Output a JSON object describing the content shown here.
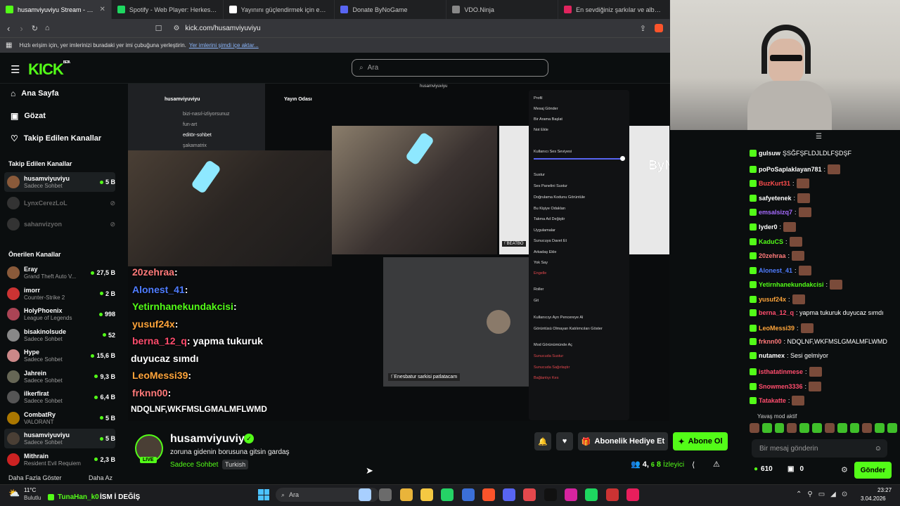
{
  "browser": {
    "tabs": [
      {
        "title": "husamviyuviyu Stream - Wat",
        "active": true,
        "color": "#53fc18"
      },
      {
        "title": "Spotify - Web Player: Herkes için mü",
        "active": false,
        "color": "#1ed760"
      },
      {
        "title": "Yayınını güçlendirmek için en iyi yaz",
        "active": false,
        "color": "#ffffff"
      },
      {
        "title": "Donate ByNoGame",
        "active": false,
        "color": "#5865f2"
      },
      {
        "title": "VDO.Ninja",
        "active": false,
        "color": "#888888"
      },
      {
        "title": "En sevdiğiniz şarkılar ve albümle",
        "active": false,
        "color": "#e0245e"
      }
    ],
    "url": "kick.com/husamviyuviyu",
    "bookmark_bar_text": "Hızlı erişim için, yer imlerinizi buradaki yer imi çubuğuna yerleştirin.",
    "bookmark_bar_link": "Yer imlerini şimdi içe aktar..."
  },
  "kick": {
    "logo": "KICK",
    "logo_beta": "BETA",
    "search_placeholder": "Ara",
    "nav": [
      {
        "label": "Ana Sayfa",
        "icon": "home-icon"
      },
      {
        "label": "Gözat",
        "icon": "browse-icon"
      },
      {
        "label": "Takip Edilen Kanallar",
        "icon": "heart-icon"
      }
    ],
    "followed_title": "Takip Edilen Kanallar",
    "followed": [
      {
        "name": "husamviyuviyu",
        "sub": "Sadece Sohbet",
        "count": "5 B",
        "live": true
      },
      {
        "name": "LynxCerezLoL",
        "sub": "",
        "count": "",
        "live": false
      },
      {
        "name": "sahanvizyon",
        "sub": "",
        "count": "",
        "live": false
      }
    ],
    "recommended_title": "Önerilen Kanallar",
    "recommended": [
      {
        "name": "Eray",
        "sub": "Grand Theft Auto V...",
        "count": "27,5 B"
      },
      {
        "name": "imorr",
        "sub": "Counter-Strike 2",
        "count": "2 B"
      },
      {
        "name": "HolyPhoenix",
        "sub": "League of Legends",
        "count": "998"
      },
      {
        "name": "bisakinolsude",
        "sub": "Sadece Sohbet",
        "count": "52"
      },
      {
        "name": "Hype",
        "sub": "Sadece Sohbet",
        "count": "15,6 B"
      },
      {
        "name": "Jahrein",
        "sub": "Sadece Sohbet",
        "count": "9,3 B"
      },
      {
        "name": "ilkerfirat",
        "sub": "Sadece Sohbet",
        "count": "6,4 B"
      },
      {
        "name": "CombatRy",
        "sub": "VALORANT",
        "count": "5 B"
      },
      {
        "name": "husamviyuviyu",
        "sub": "Sadece Sohbet",
        "count": "5 B"
      },
      {
        "name": "Mithrain",
        "sub": "Resident Evil Requiem",
        "count": "2,3 B"
      }
    ],
    "show_more": "Daha Fazla Göster",
    "show_less": "Daha Az"
  },
  "video": {
    "discord_user": "husamviyuviyu",
    "voice_room": "Yayın Odası",
    "channels": [
      "bizi-nasıl-izliyorsunuz",
      "fun-art",
      "editör-sohbet",
      "şakamatrix"
    ],
    "bynogame_logo": "ByNoGame",
    "top_label": "husamviyuviyu",
    "cam_label_1": "!`BEATBO",
    "cam_label_2": "!`Enesbatur sarkisi patlatacam",
    "overlay_chat": [
      {
        "user": "20zehraa",
        "text": ":",
        "color": "#ff7a7a"
      },
      {
        "user": "Alonest_41",
        "text": ":",
        "color": "#4f7dff"
      },
      {
        "user": "Yetirnhanekundakcisi",
        "text": ":",
        "color": "#53fc18"
      },
      {
        "user": "yusuf24x",
        "text": ":",
        "color": "#ffa53b"
      },
      {
        "user": "berna_12_q",
        "text": ": yapma tukuruk",
        "color": "#ff4d6d"
      },
      {
        "user": "",
        "text": "duyucaz sımdı",
        "color": "#ffffff"
      },
      {
        "user": "LeoMessi39",
        "text": ":",
        "color": "#ffa53b"
      },
      {
        "user": "frknn00",
        "text": ":",
        "color": "#ff7a7a"
      },
      {
        "user": "",
        "text": "NDQLNF,WKFMSLGMALMFLWMD",
        "color": "#ffffff"
      }
    ],
    "context_menu": [
      "Profil",
      "Mesaj Gönder",
      "Bir Arama Başlat",
      "Not Ekle",
      "Kullanıcı Ses Seviyesi",
      "Sustur",
      "Ses Panelini Sustur",
      "Doğrulama Kodunu Görüntüle",
      "Bu Kişiye Odaklan",
      "Takma Ad Değiştir",
      "Uygulamalar",
      "Sunucuya Davet Et",
      "Arkadaş Ekle",
      "Yok Say",
      "Engelle",
      "Roller",
      "Git",
      "Kullanıcıyı Ayrı Pencereye Al",
      "Görüntüsü Olmayan Katılımcıları Göster",
      "Mod Görünümünde Aç",
      "Sunucuda Sustur",
      "Sunucuda Sağırlaştır",
      "Bağlantıyı Kes"
    ]
  },
  "chat": {
    "messages": [
      {
        "user": "gulsuw",
        "text": "ŞSĞFŞFLDJLDLFŞDŞF",
        "color": "#ffffff"
      },
      {
        "user": "poPoSaplaklayan781",
        "text": ":",
        "color": "#ffffff"
      },
      {
        "user": "BuzKurt31",
        "text": ":",
        "color": "#ff4d4d"
      },
      {
        "user": "safyetenek",
        "text": ":",
        "color": "#ffffff"
      },
      {
        "user": "emsalsizq7",
        "text": ":",
        "color": "#a66bff"
      },
      {
        "user": "lyder0",
        "text": ":",
        "color": "#ffffff"
      },
      {
        "user": "KaduCS",
        "text": ":",
        "color": "#53fc18"
      },
      {
        "user": "20zehraa",
        "text": ":",
        "color": "#ff7a7a"
      },
      {
        "user": "Alonest_41",
        "text": ":",
        "color": "#4f7dff"
      },
      {
        "user": "Yetirnhanekundakcisi",
        "text": ":",
        "color": "#53fc18"
      },
      {
        "user": "yusuf24x",
        "text": ":",
        "color": "#ffa53b"
      },
      {
        "user": "berna_12_q",
        "text": ": yapma tukuruk duyucaz sımdı",
        "color": "#ff4d6d"
      },
      {
        "user": "LeoMessi39",
        "text": ":",
        "color": "#ffa53b"
      },
      {
        "user": "frknn00",
        "text": ": NDQLNF,WKFMSLGMALMFLWMD",
        "color": "#ff7a7a"
      },
      {
        "user": "nutamex",
        "text": ": Sesi gelmiyor",
        "color": "#ffffff"
      },
      {
        "user": "isthatatinmese",
        "text": ":",
        "color": "#ff4d6d"
      },
      {
        "user": "Snowmen3336",
        "text": ":",
        "color": "#ff4d6d"
      },
      {
        "user": "Tatakatte",
        "text": ":",
        "color": "#ff4d6d"
      }
    ],
    "slow_mode": "Yavaş mod aktif",
    "input_placeholder": "Bir mesaj gönderin",
    "points": "610",
    "store_count": "0",
    "send": "Gönder"
  },
  "stream": {
    "channel": "husamviyuviyu",
    "title": "zoruna gidenin borusuna gitsin gardaş",
    "category": "Sadece Sohbet",
    "tag": "Turkish",
    "live_badge": "LIVE",
    "gift_button": "Abonelik Hediye Et",
    "sub_button": "Abone Ol",
    "viewers_label": "İzleyici",
    "viewers_a": "4,",
    "viewers_b": "6",
    "viewers_c": "8"
  },
  "taskbar": {
    "temp": "11°C",
    "weather": "Bulutlu",
    "notif_user": "TunaHan_k0",
    "notif_text": "İSM İ DEĞİŞ",
    "search": "Ara",
    "time": "23:27",
    "date": "3.04.2026"
  }
}
